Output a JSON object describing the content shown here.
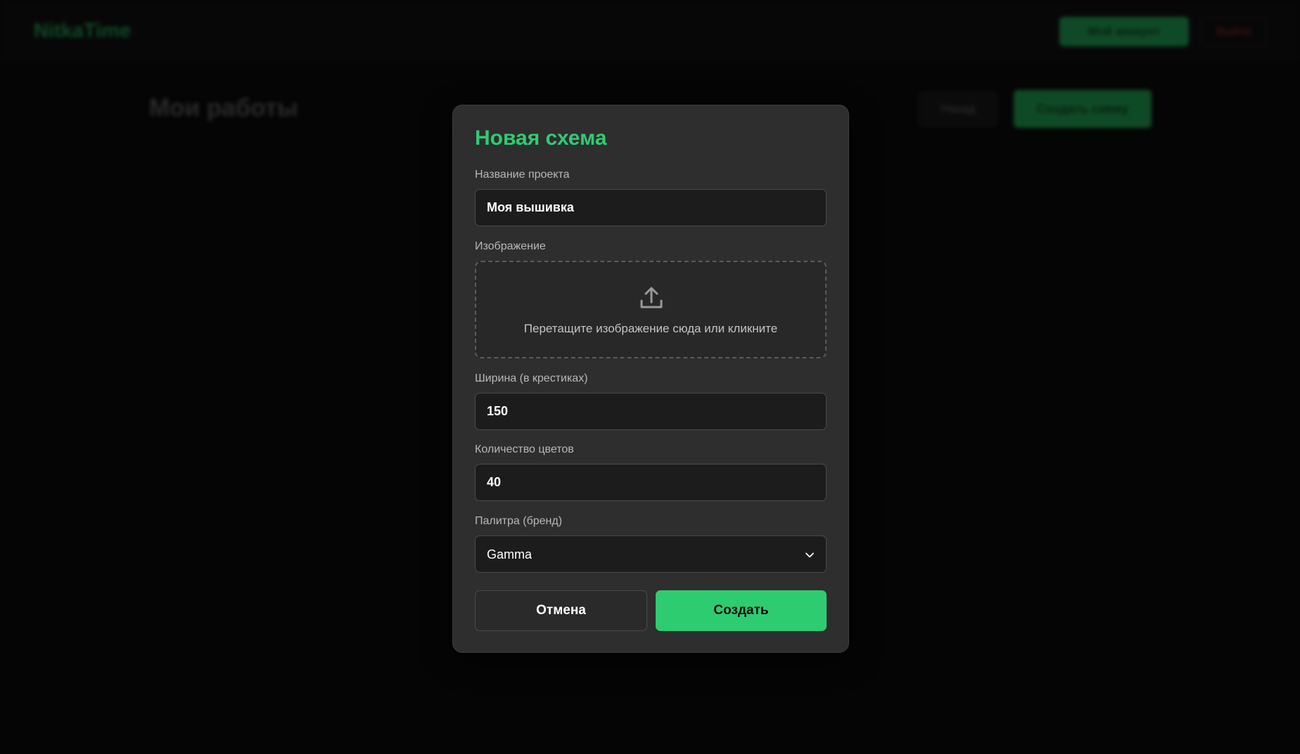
{
  "app": {
    "logo": "NitkaTime",
    "account_button": "Мой аккаунт",
    "logout_button": "Выйти"
  },
  "page": {
    "title": "Мои работы",
    "back_button": "Назад",
    "create_button": "Создать схему"
  },
  "modal": {
    "title": "Новая схема",
    "project_name": {
      "label": "Название проекта",
      "value": "Моя вышивка"
    },
    "image": {
      "label": "Изображение",
      "dropzone_text": "Перетащите изображение сюда или кликните",
      "icon": "upload-icon"
    },
    "width": {
      "label": "Ширина (в крестиках)",
      "value": "150"
    },
    "colors": {
      "label": "Количество цветов",
      "value": "40"
    },
    "palette": {
      "label": "Палитра (бренд)",
      "selected": "Gamma",
      "icon": "chevron-down-icon"
    },
    "cancel_button": "Отмена",
    "create_button": "Создать"
  },
  "theme": {
    "accent": "#2ecc71",
    "modal_bg": "#2e2e2e",
    "input_bg": "#1c1c1c",
    "page_bg": "#050505"
  }
}
